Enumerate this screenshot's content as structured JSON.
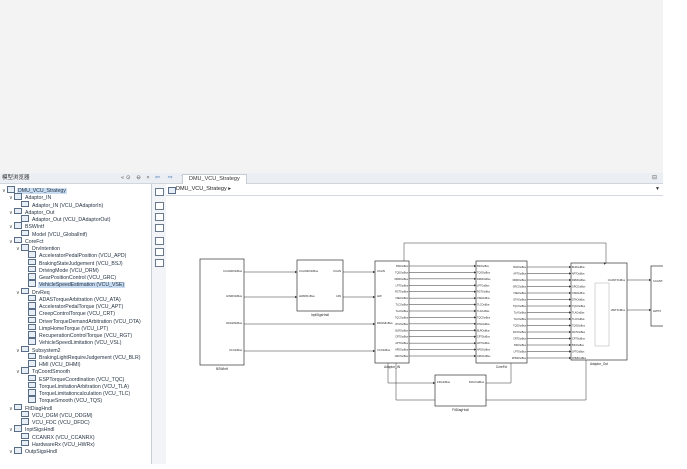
{
  "app": {
    "browser_title": "模型浏览器",
    "browser_tools": "«⊙ ⊖ ×",
    "tab_label": "DMU_VCU_Strategy",
    "nav_arrows": "⇦ ⇨ ⇧",
    "tab_close": "⊟"
  },
  "address": {
    "path": "DMU_VCU_Strategy",
    "arrow": "▸",
    "dropdown": "▼"
  },
  "tree": [
    {
      "label": "DMU_VCU_Strategy",
      "level": 0,
      "toggle": "∨",
      "selected": true
    },
    {
      "label": "Adaptor_IN",
      "level": 1,
      "toggle": "∨"
    },
    {
      "label": "Adaptor_IN (VCU_DAdaptorIn)",
      "level": 2,
      "toggle": ""
    },
    {
      "label": "Adaptor_Out",
      "level": 1,
      "toggle": "∨"
    },
    {
      "label": "Adaptor_Out (VCU_DAdaptorOut)",
      "level": 2,
      "toggle": ""
    },
    {
      "label": "BSWIntf",
      "level": 1,
      "toggle": "∨"
    },
    {
      "label": "Model (VCU_GlobalIntf)",
      "level": 2,
      "toggle": ""
    },
    {
      "label": "CoreFct",
      "level": 1,
      "toggle": "∨"
    },
    {
      "label": "DrvIntention",
      "level": 2,
      "toggle": "∨"
    },
    {
      "label": "AcceleratorPedalPosition (VCU_APD)",
      "level": 3,
      "toggle": ""
    },
    {
      "label": "BrakingStateJudgement (VCU_BSJ)",
      "level": 3,
      "toggle": ""
    },
    {
      "label": "DrivingMode (VCU_DRM)",
      "level": 3,
      "toggle": ""
    },
    {
      "label": "GearPositionControl (VCU_GRC)",
      "level": 3,
      "toggle": ""
    },
    {
      "label": "VehicleSpeedEstimation (VCU_VSE)",
      "level": 3,
      "toggle": "",
      "selected": true
    },
    {
      "label": "DrvReq",
      "level": 2,
      "toggle": "∨"
    },
    {
      "label": "ADASTorqueArbitration (VCU_ATA)",
      "level": 3,
      "toggle": ""
    },
    {
      "label": "AcceleratorPedalTorque (VCU_APT)",
      "level": 3,
      "toggle": ""
    },
    {
      "label": "CreepControlTorque (VCU_CRT)",
      "level": 3,
      "toggle": ""
    },
    {
      "label": "DriverTorqueDemandArbitration (VCU_DTA)",
      "level": 3,
      "toggle": ""
    },
    {
      "label": "LimpHomeTorque (VCU_LPT)",
      "level": 3,
      "toggle": ""
    },
    {
      "label": "RecuperationControlTorque (VCU_RGT)",
      "level": 3,
      "toggle": ""
    },
    {
      "label": "VehicleSpeedLimitation (VCU_VSL)",
      "level": 3,
      "toggle": ""
    },
    {
      "label": "Subsystem2",
      "level": 2,
      "toggle": "∨"
    },
    {
      "label": "BrakingLightRequireJudgement (VCU_BLR)",
      "level": 3,
      "toggle": ""
    },
    {
      "label": "HMI (VCU_DHMI)",
      "level": 3,
      "toggle": ""
    },
    {
      "label": "TqCoordSmooth",
      "level": 2,
      "toggle": "∨"
    },
    {
      "label": "ESPTorqueCoordination (VCU_TQC)",
      "level": 3,
      "toggle": ""
    },
    {
      "label": "TorqueLimitationArbitration (VCU_TLA)",
      "level": 3,
      "toggle": ""
    },
    {
      "label": "TorqueLimitationcalculation (VCU_TLC)",
      "level": 3,
      "toggle": ""
    },
    {
      "label": "TorqueSmooth (VCU_TQS)",
      "level": 3,
      "toggle": ""
    },
    {
      "label": "FltDiagHndl",
      "level": 1,
      "toggle": "∨"
    },
    {
      "label": "VCU_DGM (VCU_DDGM)",
      "level": 2,
      "toggle": ""
    },
    {
      "label": "VCU_FDC (VCU_DFDC)",
      "level": 2,
      "toggle": ""
    },
    {
      "label": "InptSigsHndl",
      "level": 1,
      "toggle": "∨"
    },
    {
      "label": "CCANRX (VCU_CCANRX)",
      "level": 2,
      "toggle": ""
    },
    {
      "label": "HardwareRx (VCU_HWRx)",
      "level": 2,
      "toggle": ""
    },
    {
      "label": "OutpSigsHndl",
      "level": 1,
      "toggle": "∨"
    }
  ],
  "diagram": {
    "blocks": [
      {
        "name": "BSWIntf",
        "ports_out": [
          "CCANRXInBus",
          "HWRXInBus",
          "DDGMInBus",
          "VCUInBus"
        ]
      },
      {
        "name": "InptSigsHndl",
        "ports_in": [
          "CCANRXInBus",
          "HWRXInBus"
        ],
        "ports_out": [
          "CCAN",
          "HW"
        ]
      },
      {
        "name": "Adaptor_IN",
        "ports_in": [
          "CCAN",
          "HW",
          "DDGMInBus",
          "VCUInBus"
        ]
      },
      {
        "name": "CoreFct"
      },
      {
        "name": "Adaptor_Out"
      },
      {
        "name": "FltDiagHndl",
        "ports_in": [
          "FDCInBus"
        ],
        "ports_out": [
          "FDCOutBus"
        ]
      }
    ],
    "adaptor_in_outputs": [
      "BSIOutBus",
      "TQSOutBus",
      "DRMOutBus",
      "LPTOutBus",
      "RGTOutBus",
      "VSEOutBus",
      "TLCOutBus",
      "TLAOutBus",
      "TQCOutBus",
      "DTAOutBus",
      "BLROutBus",
      "CRTOutBus",
      "APTOutBus",
      "APDOutBus",
      "GRCOutBus"
    ],
    "corefct_inputs": [
      "BSIOutBus",
      "TQSOutBus",
      "DRMOutBus",
      "LPTOutBus",
      "RGTOutBus",
      "VSEOutBus",
      "TLCOutBus",
      "TLAOutBus",
      "TQCOutBus",
      "DTAOutBus",
      "BLROutBus",
      "CRTOutBus",
      "APTOutBus",
      "APDOutBus",
      "GRCOutBus"
    ],
    "corefct_outputs": [
      "BLROutBus",
      "APTOutBus",
      "DRMOutBus",
      "GRCOutBus",
      "VSEOutBus",
      "DTAOutBus",
      "TQCOutBus",
      "TLAOutBus",
      "TLCOutBus",
      "TQSOutBus",
      "RGTOutBus",
      "CRTOutBus",
      "BSIOutBus",
      "LPTOutBus",
      "DHMIOutBus"
    ],
    "adaptor_out_inputs": [
      "BLROutBus",
      "APTOutBus",
      "DRMOutBus",
      "GRCOutBus",
      "VSEOutBus",
      "DTAOutBus",
      "TQCOutBus",
      "TLAOutBus",
      "TLCOutBus",
      "TQSOutBus",
      "RGTOutBus",
      "CRTOutBus",
      "BSIOutBus",
      "LPTOutBus",
      "DHMIOutBus"
    ],
    "adaptor_out_outputs": [
      "CCANTXInBus",
      "HWTXInBus"
    ],
    "right_partial": [
      "CCANTX",
      "HWTX"
    ]
  }
}
